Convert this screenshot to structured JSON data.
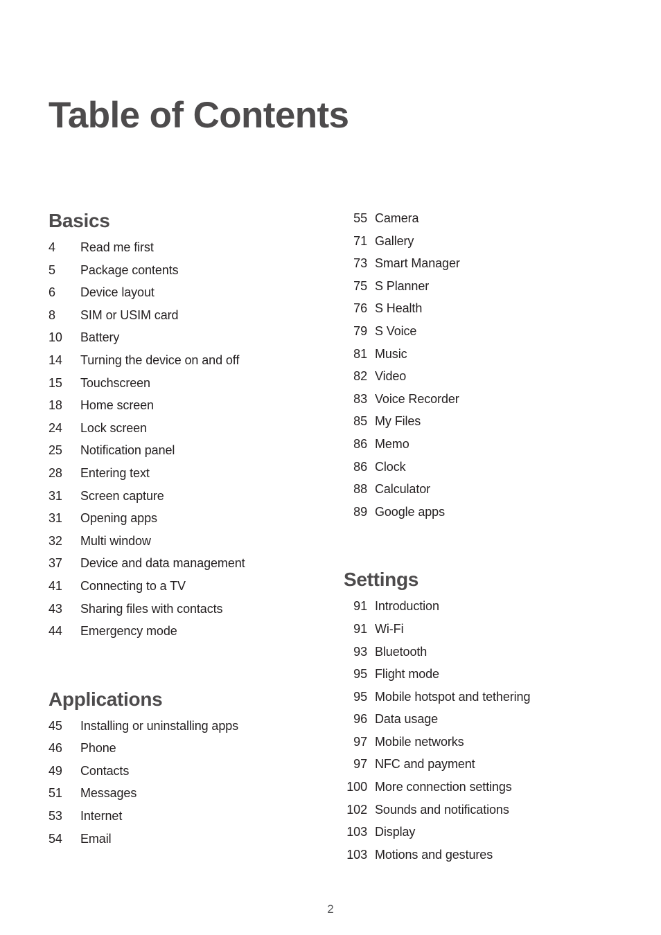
{
  "document": {
    "title": "Table of Contents",
    "page_number": "2",
    "text_color": "#231f20",
    "heading_color": "#4d4b4c",
    "background": "#ffffff"
  },
  "left_column": {
    "sections": [
      {
        "heading": "Basics",
        "entries": [
          {
            "page": "4",
            "label": "Read me first"
          },
          {
            "page": "5",
            "label": "Package contents"
          },
          {
            "page": "6",
            "label": "Device layout"
          },
          {
            "page": "8",
            "label": "SIM or USIM card"
          },
          {
            "page": "10",
            "label": "Battery"
          },
          {
            "page": "14",
            "label": "Turning the device on and off"
          },
          {
            "page": "15",
            "label": "Touchscreen"
          },
          {
            "page": "18",
            "label": "Home screen"
          },
          {
            "page": "24",
            "label": "Lock screen"
          },
          {
            "page": "25",
            "label": "Notification panel"
          },
          {
            "page": "28",
            "label": "Entering text"
          },
          {
            "page": "31",
            "label": "Screen capture"
          },
          {
            "page": "31",
            "label": "Opening apps"
          },
          {
            "page": "32",
            "label": "Multi window"
          },
          {
            "page": "37",
            "label": "Device and data management"
          },
          {
            "page": "41",
            "label": "Connecting to a TV"
          },
          {
            "page": "43",
            "label": "Sharing files with contacts"
          },
          {
            "page": "44",
            "label": "Emergency mode"
          }
        ]
      },
      {
        "heading": "Applications",
        "entries": [
          {
            "page": "45",
            "label": "Installing or uninstalling apps"
          },
          {
            "page": "46",
            "label": "Phone"
          },
          {
            "page": "49",
            "label": "Contacts"
          },
          {
            "page": "51",
            "label": "Messages"
          },
          {
            "page": "53",
            "label": "Internet"
          },
          {
            "page": "54",
            "label": "Email"
          }
        ]
      }
    ]
  },
  "right_column": {
    "sections": [
      {
        "heading": "",
        "entries": [
          {
            "page": "55",
            "label": "Camera"
          },
          {
            "page": "71",
            "label": "Gallery"
          },
          {
            "page": "73",
            "label": "Smart Manager"
          },
          {
            "page": "75",
            "label": "S Planner"
          },
          {
            "page": "76",
            "label": "S Health"
          },
          {
            "page": "79",
            "label": "S Voice"
          },
          {
            "page": "81",
            "label": "Music"
          },
          {
            "page": "82",
            "label": "Video"
          },
          {
            "page": "83",
            "label": "Voice Recorder"
          },
          {
            "page": "85",
            "label": "My Files"
          },
          {
            "page": "86",
            "label": "Memo"
          },
          {
            "page": "86",
            "label": "Clock"
          },
          {
            "page": "88",
            "label": "Calculator"
          },
          {
            "page": "89",
            "label": "Google apps"
          }
        ]
      },
      {
        "heading": "Settings",
        "entries": [
          {
            "page": "91",
            "label": "Introduction"
          },
          {
            "page": "91",
            "label": "Wi-Fi"
          },
          {
            "page": "93",
            "label": "Bluetooth"
          },
          {
            "page": "95",
            "label": "Flight mode"
          },
          {
            "page": "95",
            "label": "Mobile hotspot and tethering"
          },
          {
            "page": "96",
            "label": "Data usage"
          },
          {
            "page": "97",
            "label": "Mobile networks"
          },
          {
            "page": "97",
            "label": "NFC and payment"
          },
          {
            "page": "100",
            "label": "More connection settings"
          },
          {
            "page": "102",
            "label": "Sounds and notifications"
          },
          {
            "page": "103",
            "label": "Display"
          },
          {
            "page": "103",
            "label": "Motions and gestures"
          }
        ]
      }
    ]
  }
}
